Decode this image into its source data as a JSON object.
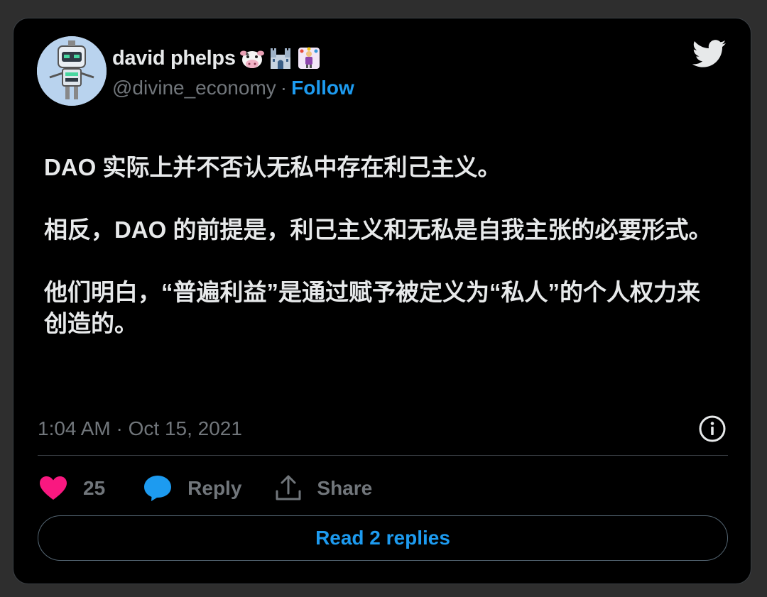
{
  "author": {
    "display_name": "david phelps",
    "handle": "@divine_economy",
    "separator": "·",
    "follow_label": "Follow",
    "emojis": [
      "cow-face",
      "castle",
      "juggler"
    ]
  },
  "tweet": {
    "paragraphs": [
      "DAO 实际上并不否认无私中存在利己主义。",
      "相反，DAO 的前提是，利己主义和无私是自我主张的必要形式。",
      "他们明白，“普遍利益”是通过赋予被定义为“私人”的个人权力来创造的。"
    ],
    "timestamp": "1:04 AM · Oct 15, 2021"
  },
  "actions": {
    "like_count": "25",
    "reply_label": "Reply",
    "share_label": "Share",
    "read_replies_label": "Read 2 replies"
  },
  "colors": {
    "background": "#000000",
    "text": "#e7e9ea",
    "muted": "#71767b",
    "accent": "#1d9bf0",
    "like": "#f91880"
  },
  "icons": [
    "twitter-bird-icon",
    "info-icon",
    "heart-icon",
    "reply-bubble-icon",
    "share-icon"
  ]
}
